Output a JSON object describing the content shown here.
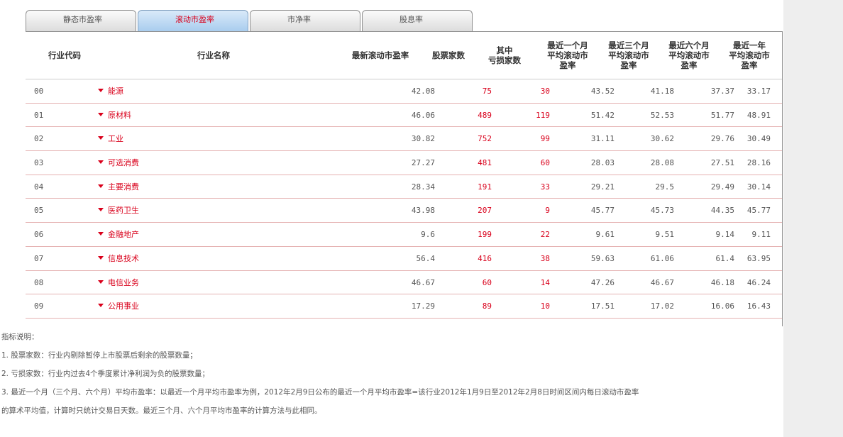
{
  "tabs": [
    {
      "label": "静态市盈率",
      "active": false
    },
    {
      "label": "滚动市盈率",
      "active": true
    },
    {
      "label": "市净率",
      "active": false
    },
    {
      "label": "股息率",
      "active": false
    }
  ],
  "headers": {
    "code": "行业代码",
    "name": "行业名称",
    "pe": "最新滚动市盈率",
    "count": "股票家数",
    "loss": "其中\n亏损家数",
    "m1": "最近一个月\n平均滚动市\n盈率",
    "m3": "最近三个月\n平均滚动市\n盈率",
    "m6": "最近六个月\n平均滚动市\n盈率",
    "y1": "最近一年\n平均滚动市\n盈率"
  },
  "rows": [
    {
      "code": "00",
      "name": "能源",
      "pe": "42.08",
      "count": "75",
      "loss": "30",
      "m1": "43.52",
      "m3": "41.18",
      "m6": "37.37",
      "y1": "33.17"
    },
    {
      "code": "01",
      "name": "原材料",
      "pe": "46.06",
      "count": "489",
      "loss": "119",
      "m1": "51.42",
      "m3": "52.53",
      "m6": "51.77",
      "y1": "48.91"
    },
    {
      "code": "02",
      "name": "工业",
      "pe": "30.82",
      "count": "752",
      "loss": "99",
      "m1": "31.11",
      "m3": "30.62",
      "m6": "29.76",
      "y1": "30.49"
    },
    {
      "code": "03",
      "name": "可选消费",
      "pe": "27.27",
      "count": "481",
      "loss": "60",
      "m1": "28.03",
      "m3": "28.08",
      "m6": "27.51",
      "y1": "28.16"
    },
    {
      "code": "04",
      "name": "主要消费",
      "pe": "28.34",
      "count": "191",
      "loss": "33",
      "m1": "29.21",
      "m3": "29.5",
      "m6": "29.49",
      "y1": "30.14"
    },
    {
      "code": "05",
      "name": "医药卫生",
      "pe": "43.98",
      "count": "207",
      "loss": "9",
      "m1": "45.77",
      "m3": "45.73",
      "m6": "44.35",
      "y1": "45.77"
    },
    {
      "code": "06",
      "name": "金融地产",
      "pe": "9.6",
      "count": "199",
      "loss": "22",
      "m1": "9.61",
      "m3": "9.51",
      "m6": "9.14",
      "y1": "9.11"
    },
    {
      "code": "07",
      "name": "信息技术",
      "pe": "56.4",
      "count": "416",
      "loss": "38",
      "m1": "59.63",
      "m3": "61.06",
      "m6": "61.4",
      "y1": "63.95"
    },
    {
      "code": "08",
      "name": "电信业务",
      "pe": "46.67",
      "count": "60",
      "loss": "14",
      "m1": "47.26",
      "m3": "46.67",
      "m6": "46.18",
      "y1": "46.24"
    },
    {
      "code": "09",
      "name": "公用事业",
      "pe": "17.29",
      "count": "89",
      "loss": "10",
      "m1": "17.51",
      "m3": "17.02",
      "m6": "16.06",
      "y1": "16.43"
    }
  ],
  "notes": {
    "title": "指标说明：",
    "lines": [
      "1. 股票家数：行业内剔除暂停上市股票后剩余的股票数量；",
      "2. 亏损家数：行业内过去4个季度累计净利润为负的股票数量；",
      "3. 最近一个月（三个月、六个月）平均市盈率：以最近一个月平均市盈率为例，2012年2月9日公布的最近一个月平均市盈率=该行业2012年1月9日至2012年2月8日时间区间内每日滚动市盈率",
      "的算术平均值，计算时只统计交易日天数。最近三个月、六个月平均市盈率的计算方法与此相同。"
    ]
  },
  "colors": {
    "accent_red": "#d9001b",
    "tab_active_bg": "#a9cdee",
    "row_border": "#e5b2b2"
  }
}
